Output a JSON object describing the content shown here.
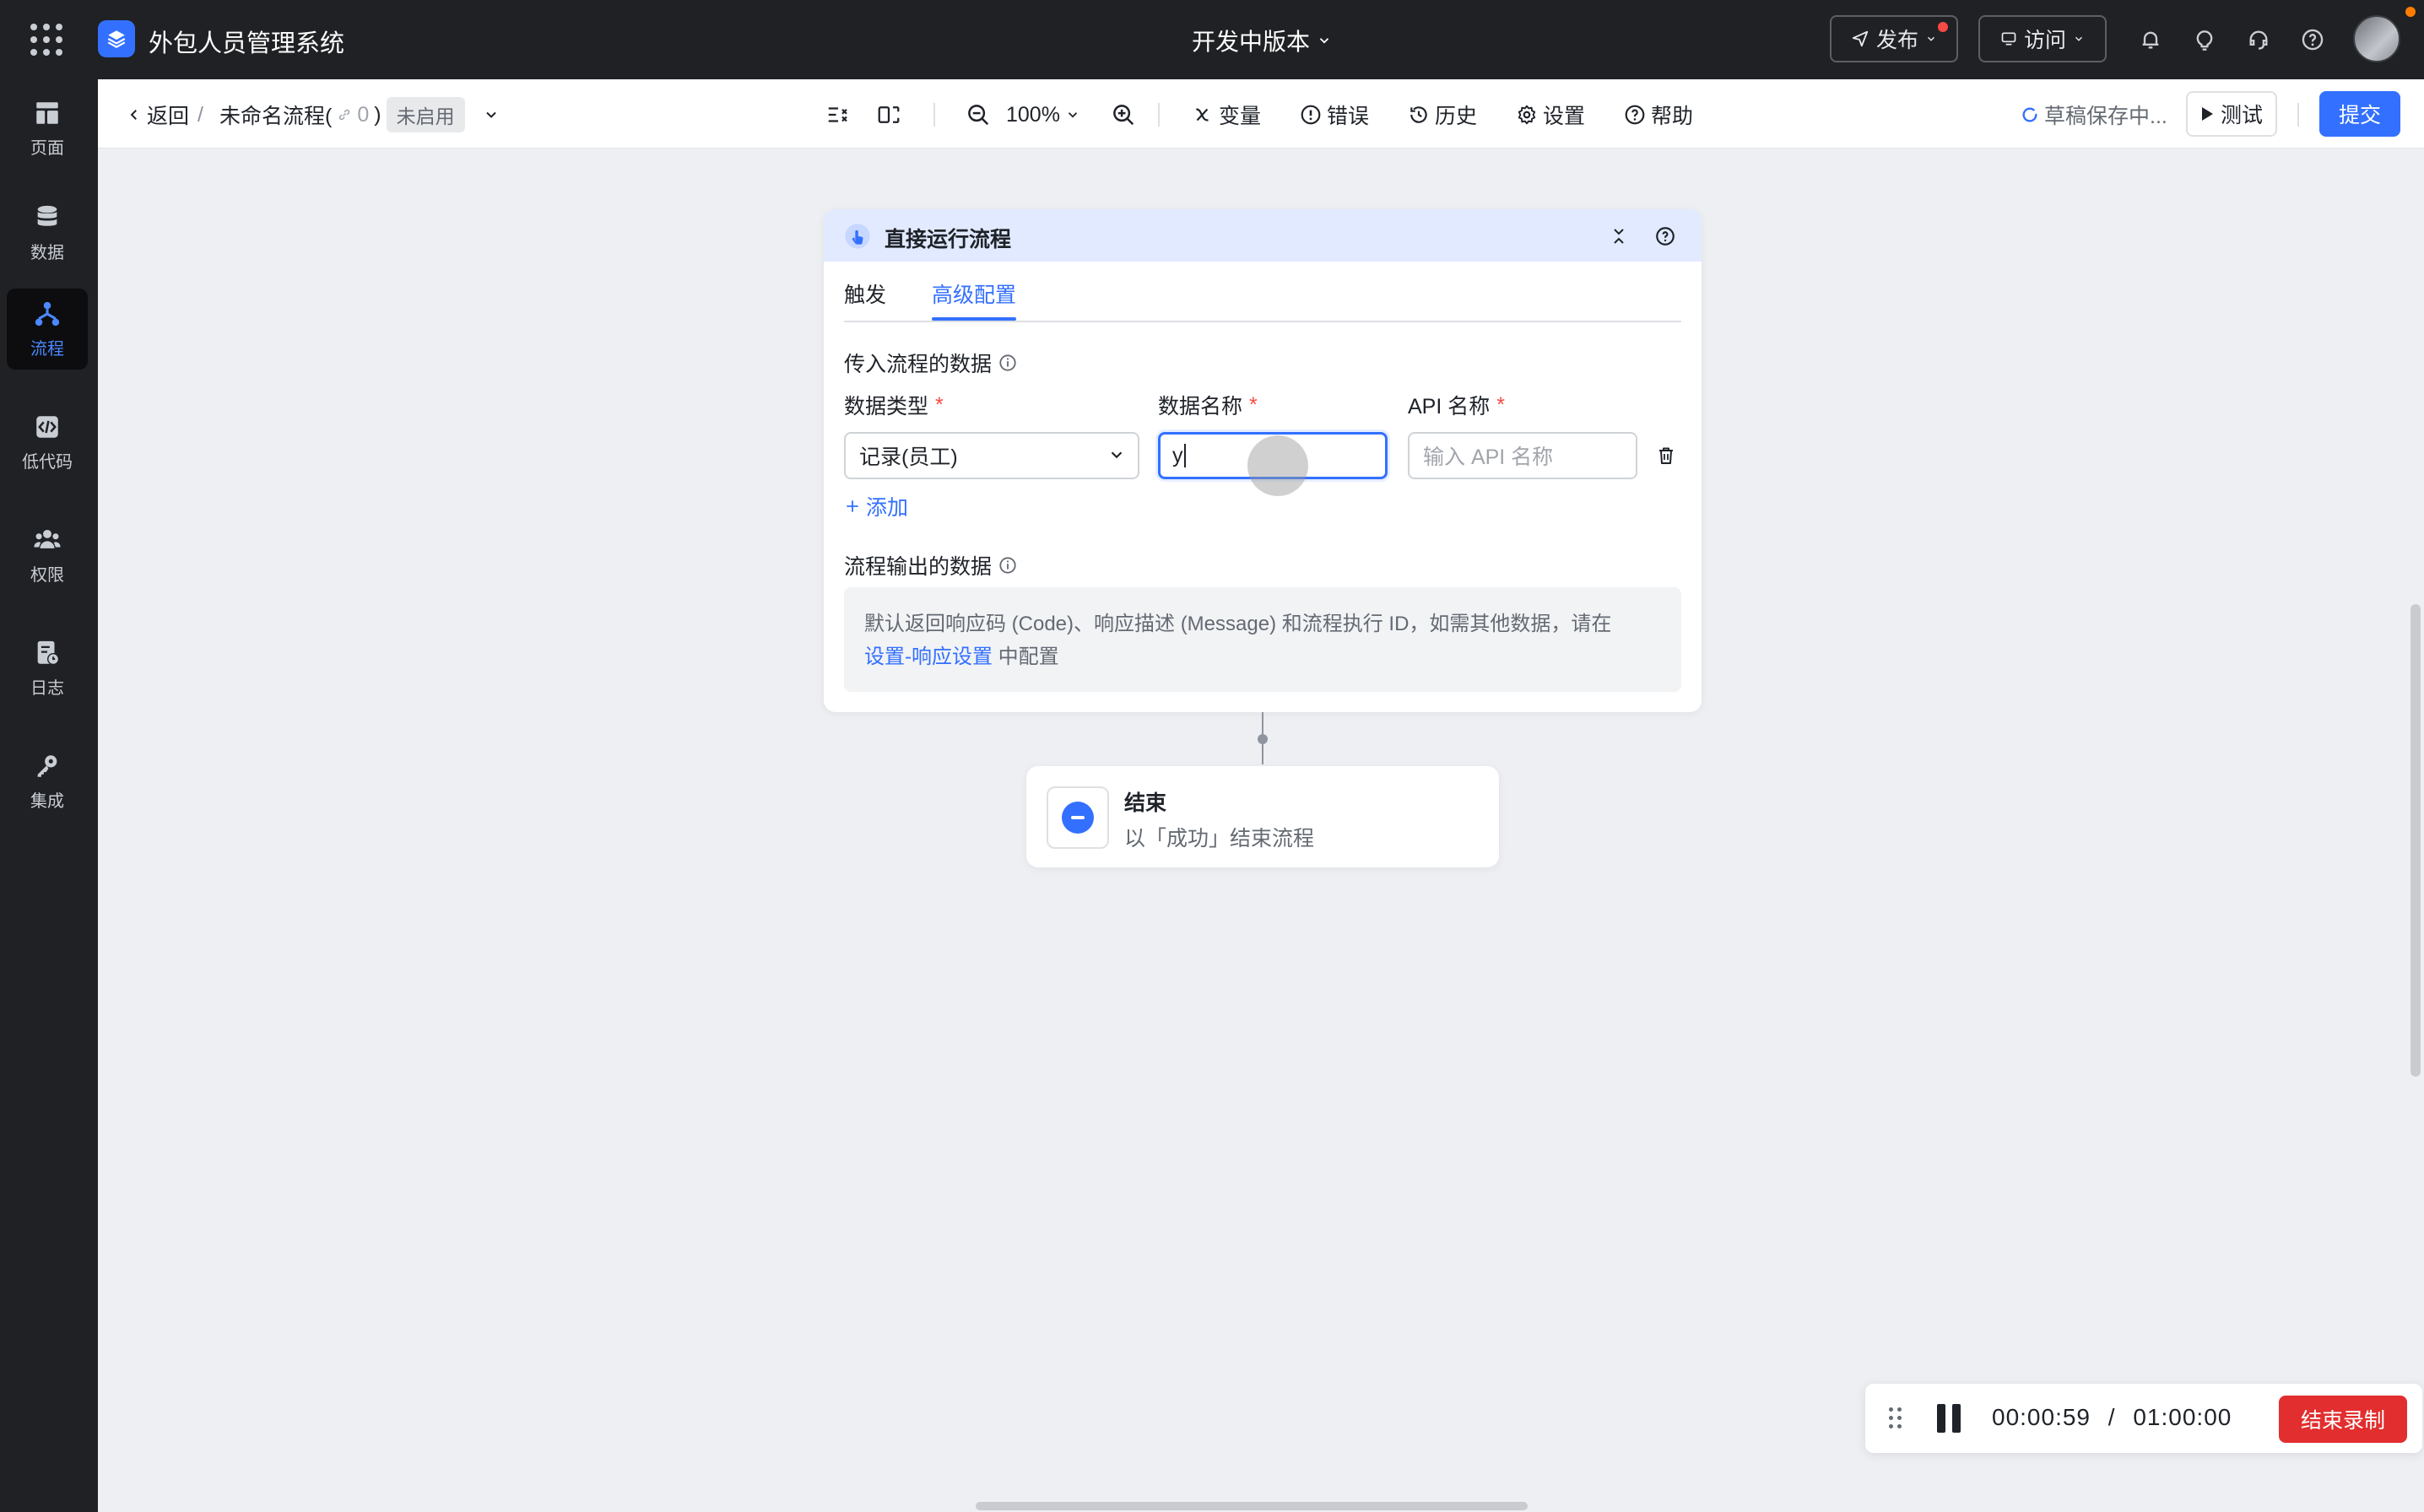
{
  "topbar": {
    "app_title": "外包人员管理系统",
    "version_label": "开发中版本",
    "publish_label": "发布",
    "visit_label": "访问"
  },
  "sidebar": {
    "items": [
      {
        "label": "页面",
        "icon": "page-icon"
      },
      {
        "label": "数据",
        "icon": "database-icon"
      },
      {
        "label": "流程",
        "icon": "flow-icon",
        "active": true
      },
      {
        "label": "低代码",
        "icon": "code-icon"
      },
      {
        "label": "权限",
        "icon": "users-icon"
      },
      {
        "label": "日志",
        "icon": "log-icon"
      },
      {
        "label": "集成",
        "icon": "key-icon"
      }
    ]
  },
  "toolbar": {
    "back_label": "返回",
    "breadcrumb_sep": "/",
    "flow_name": "未命名流程(",
    "link_count": "0",
    "flow_name_close": ")",
    "status_badge": "未启用",
    "zoom_level": "100%",
    "variables_label": "变量",
    "errors_label": "错误",
    "history_label": "历史",
    "settings_label": "设置",
    "help_label": "帮助",
    "save_status": "草稿保存中...",
    "test_label": "测试",
    "submit_label": "提交"
  },
  "trigger_card": {
    "title": "直接运行流程",
    "tabs": [
      {
        "label": "触发",
        "active": false
      },
      {
        "label": "高级配置",
        "active": true
      }
    ],
    "input_section_title": "传入流程的数据",
    "fields": {
      "data_type_label": "数据类型",
      "data_name_label": "数据名称",
      "api_name_label": "API 名称",
      "required_mark": "*"
    },
    "row": {
      "data_type_value": "记录(员工)",
      "data_name_value": "y",
      "api_name_placeholder": "输入 API 名称"
    },
    "add_label": "添加",
    "output_section_title": "流程输出的数据",
    "output_desc": "默认返回响应码 (Code)、响应描述 (Message) 和流程执行 ID，如需其他数据，请在",
    "output_link": "设置-响应设置",
    "output_tail": "中配置"
  },
  "end_node": {
    "title": "结束",
    "description": "以「成功」结束流程"
  },
  "recording": {
    "elapsed": "00:00:59",
    "separator": "/",
    "limit": "01:00:00",
    "stop_label": "结束录制"
  },
  "colors": {
    "accent": "#3370ff",
    "topbar_bg": "#202124",
    "canvas_bg": "#eeeff3",
    "card_header_bg": "#e1eaff",
    "danger": "#e22e2e"
  }
}
